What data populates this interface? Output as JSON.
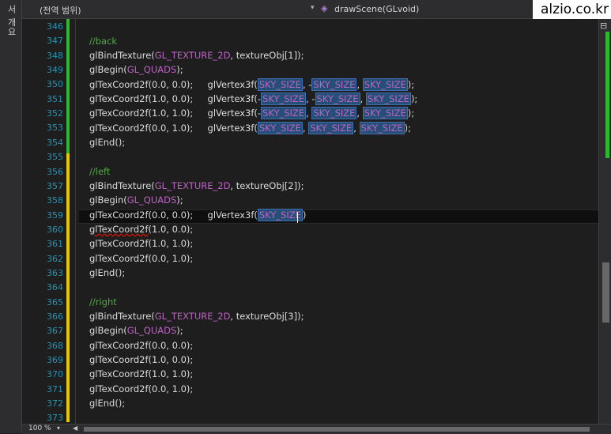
{
  "side_panel": {
    "label": "서 개요"
  },
  "navbar": {
    "scope": "(전역 범위)",
    "function": "drawScene(GLvoid)",
    "arrow": "▾"
  },
  "watermark": "alzio.co.kr",
  "line_numbers": [
    "346",
    "347",
    "348",
    "349",
    "350",
    "351",
    "352",
    "353",
    "354",
    "355",
    "356",
    "357",
    "358",
    "359",
    "360",
    "361",
    "362",
    "363",
    "364",
    "365",
    "366",
    "367",
    "368",
    "369",
    "370",
    "371",
    "372",
    "373"
  ],
  "code": {
    "l347": "//back",
    "l348a": "glBindTexture(",
    "l348m": "GL_TEXTURE_2D",
    "l348b": ", textureObj[1]);",
    "l349a": "glBegin(",
    "l349m": "GL_QUADS",
    "l349b": ");",
    "l350a": "glTexCoord2f(0.0, 0.0);     glVertex3f(",
    "l350h1": "SKY_SIZE",
    "l350s1": ", -",
    "l350h2": "SKY_SIZE",
    "l350s2": ", ",
    "l350h3": "SKY_SIZE",
    "l350e": ");",
    "l351a": "glTexCoord2f(1.0, 0.0);     glVertex3f(-",
    "l351h1": "SKY_SIZE",
    "l351s1": ", -",
    "l351h2": "SKY_SIZE",
    "l351s2": ", ",
    "l351h3": "SKY_SIZE",
    "l351e": ");",
    "l352a": "glTexCoord2f(1.0, 1.0);     glVertex3f(-",
    "l352h1": "SKY_SIZE",
    "l352s1": ", ",
    "l352h2": "SKY_SIZE",
    "l352s2": ", ",
    "l352h3": "SKY_SIZE",
    "l352e": ");",
    "l353a": "glTexCoord2f(0.0, 1.0);     glVertex3f(",
    "l353h1": "SKY_SIZE",
    "l353s1": ", ",
    "l353h2": "SKY_SIZE",
    "l353s2": ", ",
    "l353h3": "SKY_SIZE",
    "l353e": ");",
    "l354": "glEnd();",
    "l356": "//left",
    "l357a": "glBindTexture(",
    "l357m": "GL_TEXTURE_2D",
    "l357b": ", textureObj[2]);",
    "l358a": "glBegin(",
    "l358m": "GL_QUADS",
    "l358b": ");",
    "l359a": "glTexCoord2f(0.0, 0.0);     glVertex3f(",
    "l359h1": "SKY_SIZE",
    "l359e": ")",
    "l360a": "glTexCoord2f",
    "l360b": "(1.0, 0.0);",
    "l361": "glTexCoord2f(1.0, 1.0);",
    "l362": "glTexCoord2f(0.0, 1.0);",
    "l363": "glEnd();",
    "l365": "//right",
    "l366a": "glBindTexture(",
    "l366m": "GL_TEXTURE_2D",
    "l366b": ", textureObj[3]);",
    "l367a": "glBegin(",
    "l367m": "GL_QUADS",
    "l367b": ");",
    "l368": "glTexCoord2f(0.0, 0.0);",
    "l369": "glTexCoord2f(1.0, 0.0);",
    "l370": "glTexCoord2f(1.0, 1.0);",
    "l371": "glTexCoord2f(0.0, 1.0);",
    "l372": "glEnd();"
  },
  "statusbar": {
    "zoom": "100 %",
    "zoom_arrow": "▾",
    "scroll_left": "◀"
  },
  "scrollbar": {
    "split": "⊟"
  },
  "colors": {
    "added": "#2eb82e",
    "modified": "#e6c700",
    "comment": "#57a64a",
    "macro": "#bd63c5",
    "line_number": "#2b91af"
  }
}
